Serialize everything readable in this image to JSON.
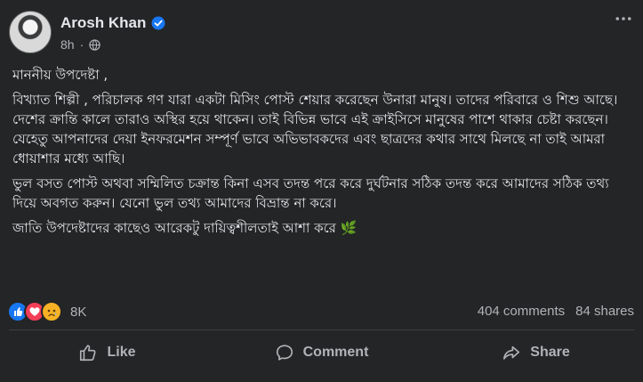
{
  "post": {
    "author": "Arosh Khan",
    "time": "8h",
    "paragraphs": [
      "মাননীয় উপদেষ্টা ,",
      "বিখ্যাত শিল্পী , পরিচালক গণ যারা একটা মিসিং পোস্ট শেয়ার করেছেন উনারা মানুষ। তাদের পরিবারে ও শিশু আছে।  দেশের ক্রান্তি কালে তারাও অস্থির হয়ে থাকেন। তাই বিভিন্ন ভাবে এই ক্রাইসিসে মানুষের পাশে থাকার চেষ্টা করছেন। যেহেতু আপনাদের দেয়া ইনফরমেশন সম্পূর্ণ ভাবে অভিভাবকদের এবং ছাত্রদের কথার সাথে মিলছে না তাই আমরা ধোয়াশার মধ্যে আছি।",
      "ভুল বসত পোস্ট অথবা সম্মিলিত চক্রান্ত কিনা এসব তদন্ত পরে করে দুর্ঘটনার সঠিক তদন্ত করে আমাদের সঠিক তথ্য দিয়ে অবগত করুন। যেনো ভুল তথ্য আমাদের বিভ্রান্ত না করে।",
      "জাতি উপদেষ্টাদের কাছেও আরেকটু দায়িত্বশীলতাই আশা করে 🌿"
    ]
  },
  "engagement": {
    "reaction_count": "8K",
    "comments": "404 comments",
    "shares": "84 shares"
  },
  "actions": {
    "like": "Like",
    "comment": "Comment",
    "share": "Share"
  },
  "icons": [
    "avatar",
    "verified-icon",
    "globe-icon",
    "more-icon",
    "like-reaction-icon",
    "love-reaction-icon",
    "sad-reaction-icon",
    "thumbs-up-icon",
    "comment-icon",
    "share-icon"
  ],
  "colors": {
    "background": "#242526",
    "text": "#e4e6eb",
    "secondary_text": "#b0b3b8",
    "verified": "#1877f2"
  }
}
